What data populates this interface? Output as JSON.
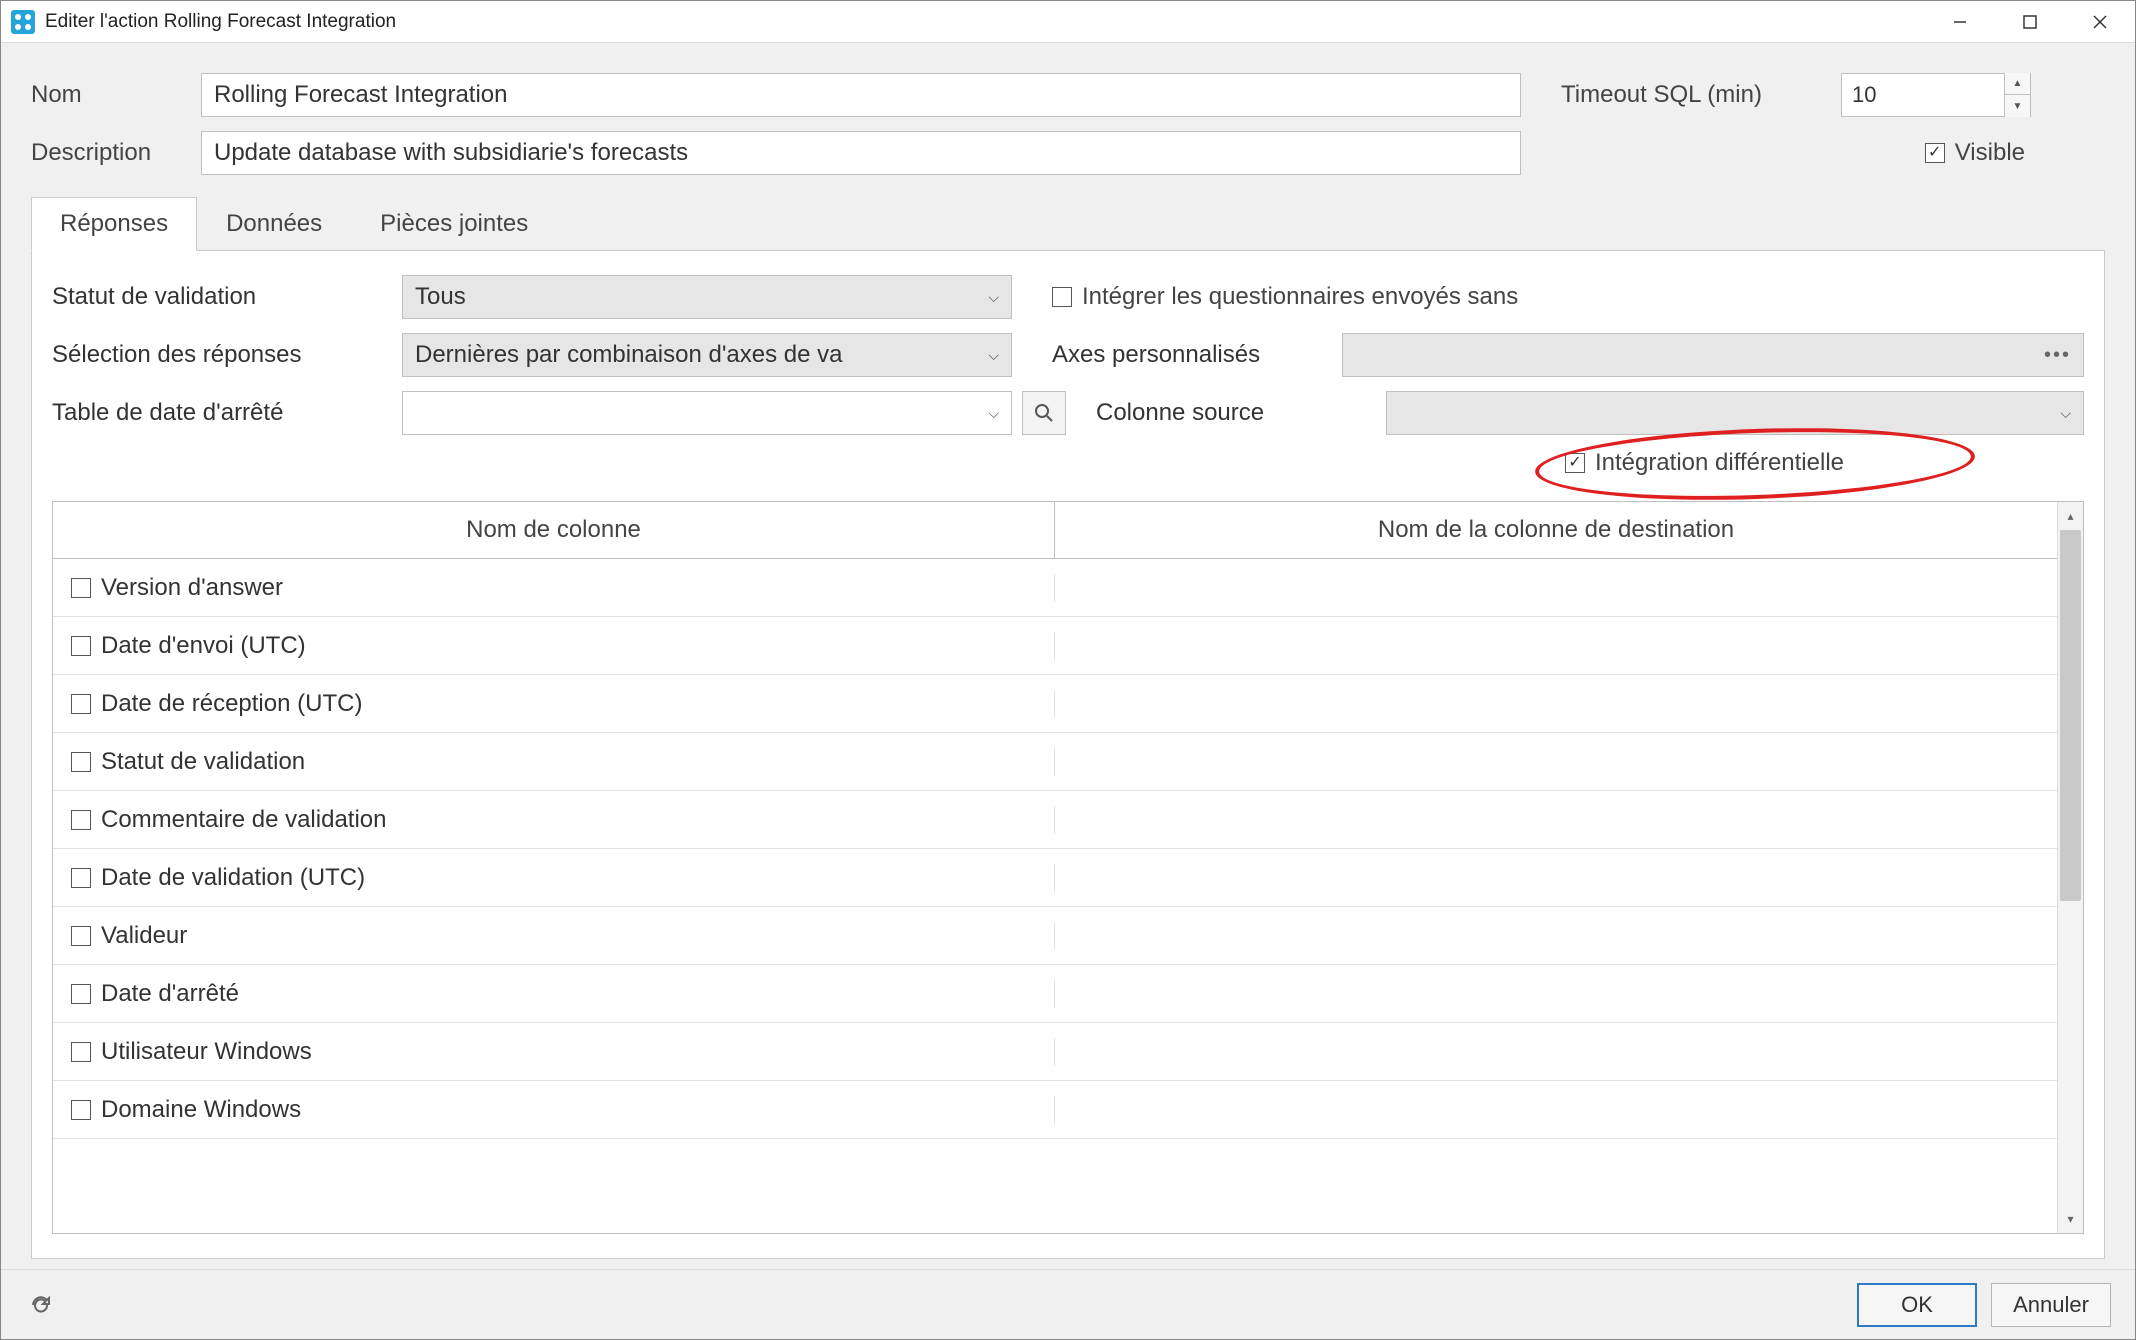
{
  "window": {
    "title": "Editer l'action Rolling Forecast Integration"
  },
  "form": {
    "name_label": "Nom",
    "name_value": "Rolling Forecast Integration",
    "desc_label": "Description",
    "desc_value": "Update database with subsidiarie's forecasts",
    "timeout_label": "Timeout SQL (min)",
    "timeout_value": "10",
    "visible_label": "Visible"
  },
  "tabs": {
    "t1": "Réponses",
    "t2": "Données",
    "t3": "Pièces jointes"
  },
  "filters": {
    "status_label": "Statut de validation",
    "status_value": "Tous",
    "selection_label": "Sélection des réponses",
    "selection_value": "Dernières par combinaison d'axes de va",
    "closingdate_label": "Table de date d'arrêté",
    "closingdate_value": "",
    "integrate_noanswer_label": "Intégrer les questionnaires envoyés sans",
    "custom_axes_label": "Axes personnalisés",
    "source_col_label": "Colonne source",
    "diff_integration_label": "Intégration différentielle"
  },
  "table": {
    "header1": "Nom de colonne",
    "header2": "Nom de la colonne de destination",
    "rows": [
      "Version d'answer",
      "Date d'envoi (UTC)",
      "Date de réception (UTC)",
      "Statut de validation",
      "Commentaire de validation",
      "Date de validation (UTC)",
      "Valideur",
      "Date d'arrêté",
      "Utilisateur Windows",
      "Domaine Windows"
    ]
  },
  "footer": {
    "ok": "OK",
    "cancel": "Annuler"
  }
}
